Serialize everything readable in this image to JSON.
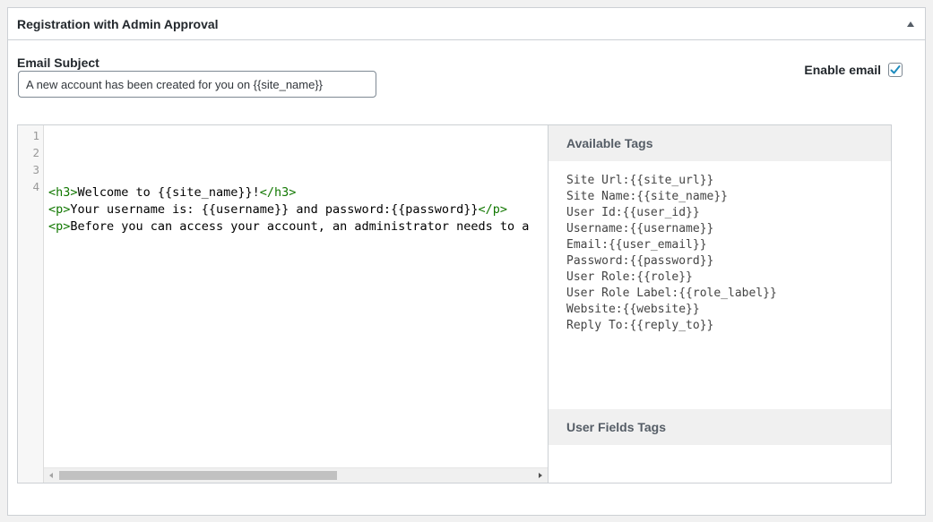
{
  "panel": {
    "title": "Registration with Admin Approval"
  },
  "subject": {
    "label": "Email Subject",
    "value": "A new account has been created for you on {{site_name}}"
  },
  "enable": {
    "label": "Enable email",
    "checked": true
  },
  "editor": {
    "line_numbers": [
      "1",
      "2",
      "3",
      "4"
    ],
    "lines": [
      [
        {
          "t": "<h3>",
          "tag": true
        },
        {
          "t": "Welcome to {{site_name}}!",
          "tag": false
        },
        {
          "t": "</h3>",
          "tag": true
        }
      ],
      [
        {
          "t": "<p>",
          "tag": true
        },
        {
          "t": "Your username is: {{username}} and password:{{password}}",
          "tag": false
        },
        {
          "t": "</p>",
          "tag": true
        }
      ],
      [
        {
          "t": "<p>",
          "tag": true
        },
        {
          "t": "Before you can access your account, an administrator needs to a",
          "tag": false
        }
      ],
      []
    ]
  },
  "available_tags": {
    "title": "Available Tags",
    "items": [
      "Site Url:{{site_url}}",
      "Site Name:{{site_name}}",
      "User Id:{{user_id}}",
      "Username:{{username}}",
      "Email:{{user_email}}",
      "Password:{{password}}",
      "User Role:{{role}}",
      "User Role Label:{{role_label}}",
      "Website:{{website}}",
      "Reply To:{{reply_to}}"
    ]
  },
  "user_fields_tags": {
    "title": "User Fields Tags"
  },
  "colors": {
    "accent": "#1e8cbe",
    "tag": "#117700"
  }
}
